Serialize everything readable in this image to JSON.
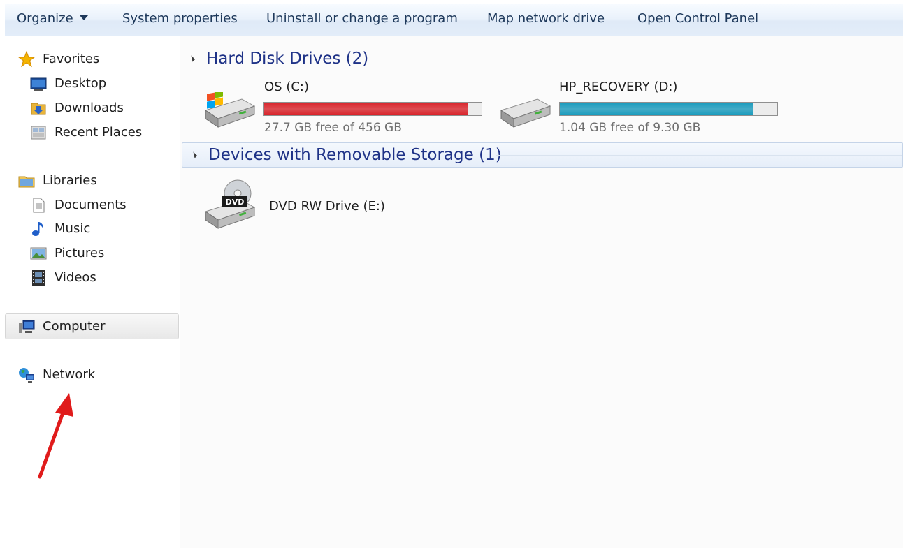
{
  "toolbar": {
    "organize": "Organize",
    "system_properties": "System properties",
    "uninstall": "Uninstall or change a program",
    "map_network": "Map network drive",
    "open_control_panel": "Open Control Panel"
  },
  "nav": {
    "favorites": {
      "label": "Favorites",
      "icon": "star-icon"
    },
    "favorites_items": [
      {
        "label": "Desktop",
        "icon": "desktop-icon"
      },
      {
        "label": "Downloads",
        "icon": "downloads-icon"
      },
      {
        "label": "Recent Places",
        "icon": "recent-places-icon"
      }
    ],
    "libraries": {
      "label": "Libraries",
      "icon": "libraries-icon"
    },
    "libraries_items": [
      {
        "label": "Documents",
        "icon": "documents-icon"
      },
      {
        "label": "Music",
        "icon": "music-icon"
      },
      {
        "label": "Pictures",
        "icon": "pictures-icon"
      },
      {
        "label": "Videos",
        "icon": "videos-icon"
      }
    ],
    "computer": {
      "label": "Computer",
      "icon": "computer-icon"
    },
    "network": {
      "label": "Network",
      "icon": "network-icon"
    }
  },
  "groups": {
    "hard_disk": {
      "title": "Hard Disk Drives (2)"
    },
    "removable": {
      "title": "Devices with Removable Storage (1)"
    }
  },
  "drives": [
    {
      "name": "OS (C:)",
      "free_text": "27.7 GB free of 456 GB",
      "used_fraction": 0.94,
      "bar_color": "#d9242b",
      "icon": "windows-drive-icon"
    },
    {
      "name": "HP_RECOVERY (D:)",
      "free_text": "1.04 GB free of 9.30 GB",
      "used_fraction": 0.89,
      "bar_color": "#1a9bbd",
      "icon": "hard-drive-icon"
    }
  ],
  "removable_drives": [
    {
      "name": "DVD RW Drive (E:)",
      "icon": "dvd-drive-icon",
      "badge": "DVD"
    }
  ],
  "annotation": {
    "arrow_color": "#e01b1b"
  }
}
